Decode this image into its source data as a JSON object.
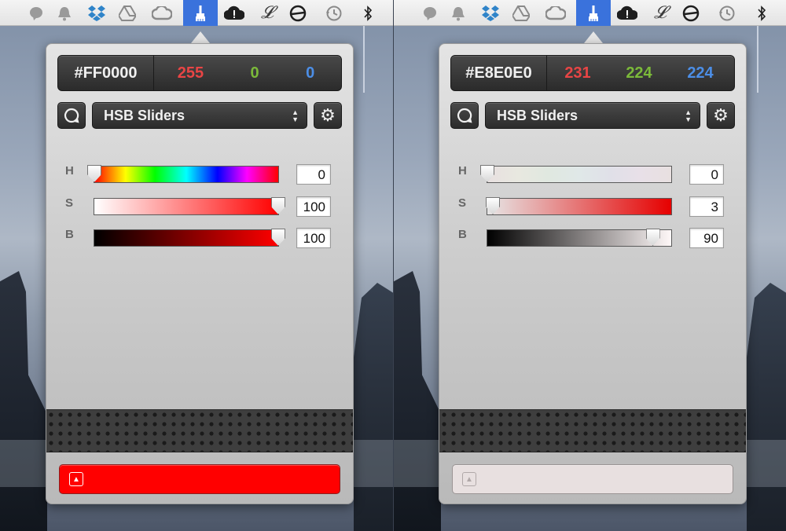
{
  "menubar": {
    "icons": [
      "speech-bubble-icon",
      "bell-icon",
      "dropbox-icon",
      "google-drive-icon",
      "creative-cloud-icon",
      "paintbrush-icon",
      "cloud-alert-icon",
      "script-l-icon",
      "circle-slash-icon",
      "time-machine-icon",
      "bluetooth-icon"
    ]
  },
  "panels": [
    {
      "hex": "#FF0000",
      "rgb": {
        "r": "255",
        "g": "0",
        "b": "0"
      },
      "mode_label": "HSB Sliders",
      "sliders": [
        {
          "label": "H",
          "value": "0",
          "fraction": 0.0
        },
        {
          "label": "S",
          "value": "100",
          "fraction": 1.0
        },
        {
          "label": "B",
          "value": "100",
          "fraction": 1.0
        }
      ],
      "swatch_color": "#FF0000"
    },
    {
      "hex": "#E8E0E0",
      "rgb": {
        "r": "231",
        "g": "224",
        "b": "224"
      },
      "mode_label": "HSB Sliders",
      "sliders": [
        {
          "label": "H",
          "value": "0",
          "fraction": 0.0
        },
        {
          "label": "S",
          "value": "3",
          "fraction": 0.03
        },
        {
          "label": "B",
          "value": "90",
          "fraction": 0.9
        }
      ],
      "swatch_color": "#E8E0E0"
    }
  ],
  "colors": {
    "red_channel": "#e84545",
    "green_channel": "#7bb93a",
    "blue_channel": "#4c8ee6",
    "menubar_active": "#3a72dc"
  }
}
